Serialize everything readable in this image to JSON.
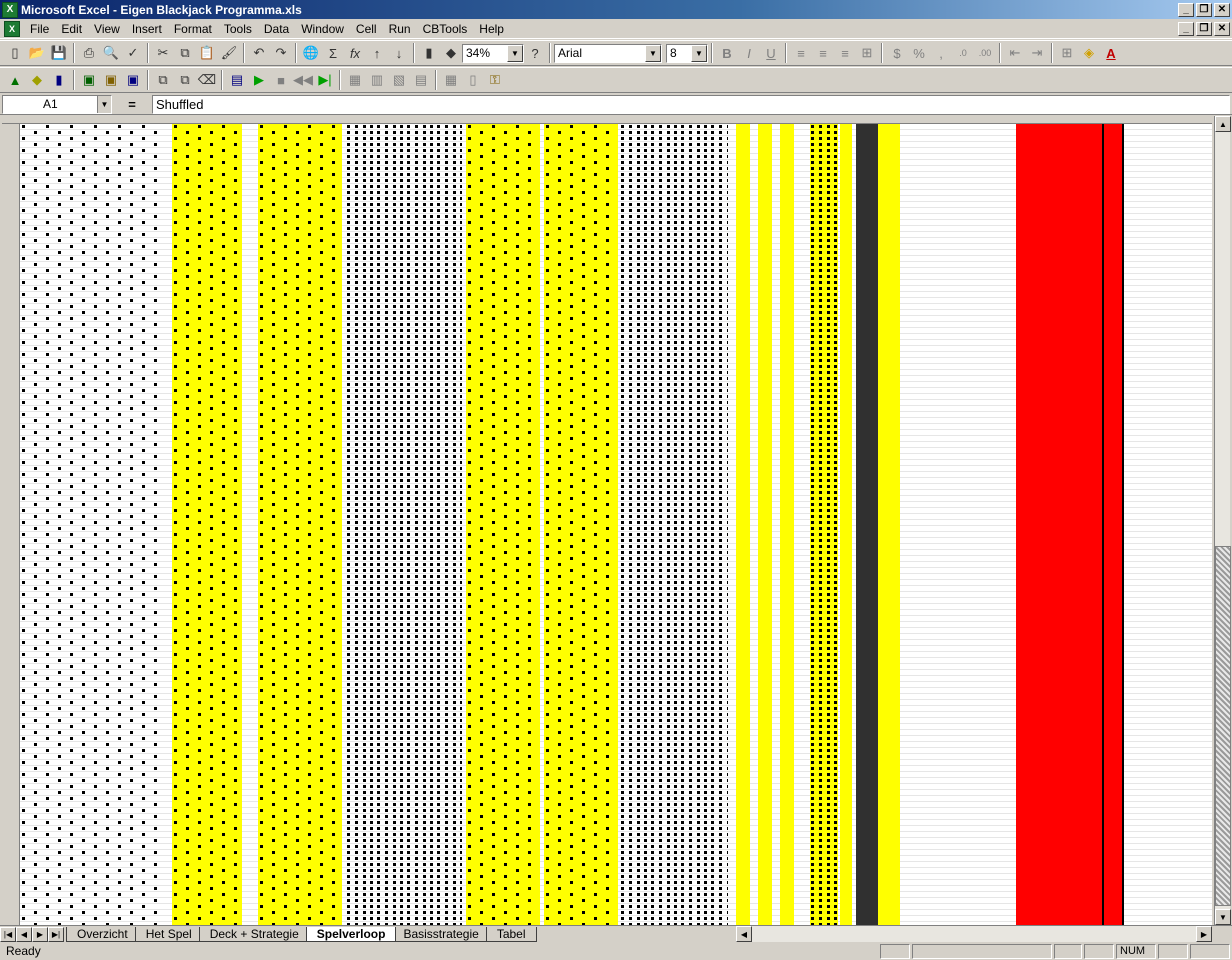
{
  "window": {
    "title": "Microsoft Excel - Eigen Blackjack Programma.xls"
  },
  "menu": [
    "File",
    "Edit",
    "View",
    "Insert",
    "Format",
    "Tools",
    "Data",
    "Window",
    "Cell",
    "Run",
    "CBTools",
    "Help"
  ],
  "toolbar": {
    "zoom": "34%",
    "font": "Arial",
    "font_size": "8"
  },
  "formula": {
    "cell_ref": "A1",
    "eq": "=",
    "content": "Shuffled"
  },
  "sheet_tabs": [
    "Overzicht",
    "Het Spel",
    "Deck + Strategie",
    "Spelverloop",
    "Basisstrategie",
    "Tabel"
  ],
  "active_tab": "Spelverloop",
  "status": {
    "text": "Ready",
    "num": "NUM"
  },
  "colors": {
    "highlight": "#ffff00",
    "alert": "#ff0000",
    "titlebar": "#0a246a"
  }
}
